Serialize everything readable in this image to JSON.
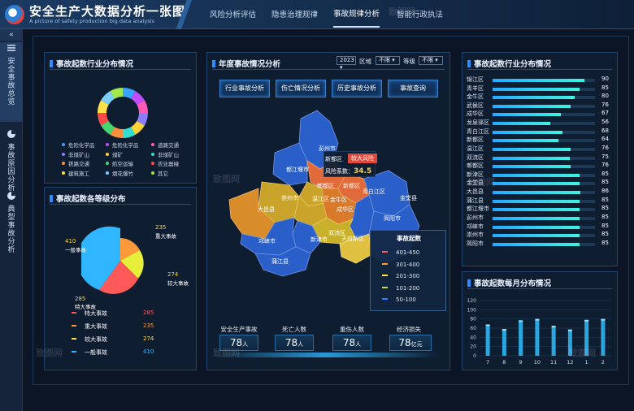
{
  "header": {
    "title": "安全生产大数据分析一张图",
    "subtitle": "A picture of safety production big data analysis",
    "nav": [
      "风险分析评估",
      "隐患治理规律",
      "事故规律分析",
      "智能行政执法"
    ],
    "active_nav": 2
  },
  "sidebar": {
    "collapse_icon": "«",
    "items": [
      {
        "label": "安全事故总览",
        "icon": "menu-icon"
      },
      {
        "label": "事故原因分析",
        "icon": "pie-icon"
      },
      {
        "label": "典型事故分析",
        "icon": "pie-icon"
      }
    ]
  },
  "industry_panel": {
    "title": "事故起数行业分布情况",
    "legend": [
      {
        "label": "危险化学品",
        "color": "#3aa3ff"
      },
      {
        "label": "危险化学品",
        "color": "#c04bff"
      },
      {
        "label": "道路交通",
        "color": "#ff5bb6"
      },
      {
        "label": "非煤矿山",
        "color": "#8a7dff"
      },
      {
        "label": "煤矿",
        "color": "#ffd23a"
      },
      {
        "label": "非煤矿山",
        "color": "#31e0d0"
      },
      {
        "label": "铁路交通",
        "color": "#ff8e3a"
      },
      {
        "label": "航空运输",
        "color": "#45d66f"
      },
      {
        "label": "农业器械",
        "color": "#ff4a4a"
      },
      {
        "label": "建筑施工",
        "color": "#ffe14a"
      },
      {
        "label": "烟花爆竹",
        "color": "#7cd0ff"
      },
      {
        "label": "其它",
        "color": "#a3e84a"
      }
    ]
  },
  "grade_panel": {
    "title": "事故起数各等级分布",
    "labels": [
      {
        "value": "235",
        "name": "重大事故"
      },
      {
        "value": "410",
        "name": "一般事故"
      },
      {
        "value": "274",
        "name": "较大事故"
      },
      {
        "value": "285",
        "name": "特大事故"
      }
    ],
    "rows": [
      {
        "name": "特大事故",
        "value": "285",
        "color": "#ff5a5a"
      },
      {
        "name": "重大事故",
        "value": "235",
        "color": "#ff9a3a"
      },
      {
        "name": "较大事故",
        "value": "274",
        "color": "#ffe14a"
      },
      {
        "name": "一般事故",
        "value": "410",
        "color": "#2fb6ff"
      }
    ]
  },
  "center": {
    "title": "年度事故情况分析",
    "year": "2023",
    "district_label": "区域",
    "district_value": "不限",
    "level_label": "等级",
    "level_value": "不限",
    "tabs": [
      "行业事故分析",
      "伤亡情况分析",
      "历史事故分析",
      "事故查询"
    ],
    "tooltip": {
      "city": "新都区",
      "risk": "较大风险",
      "coef_label": "风险系数：",
      "coef": "34.5"
    },
    "map_labels": [
      "彭州市",
      "都江堰市",
      "新都区",
      "郫都区",
      "崇州市",
      "温江区",
      "青白江区",
      "金堂县",
      "大邑县",
      "金牛区",
      "成华区",
      "双流区",
      "邛崃市",
      "新津市",
      "蒲江县",
      "天府新区",
      "简阳市"
    ],
    "legend": {
      "title": "事故起数",
      "items": [
        {
          "label": "401-450",
          "color": "#ff5a5a"
        },
        {
          "label": "301-400",
          "color": "#ff9a3a"
        },
        {
          "label": "201-300",
          "color": "#ffe14a"
        },
        {
          "label": "101-200",
          "color": "#d6d64a"
        },
        {
          "label": "50-100",
          "color": "#2f7fff"
        }
      ]
    },
    "stats": [
      {
        "label": "安全生产事故",
        "value": "78",
        "unit": "人"
      },
      {
        "label": "死亡人数",
        "value": "78",
        "unit": "人"
      },
      {
        "label": "重伤人数",
        "value": "78",
        "unit": "人"
      },
      {
        "label": "经济损失",
        "value": "78",
        "unit": "亿元"
      }
    ]
  },
  "district_panel": {
    "title": "事故起数行业分布情况",
    "rows": [
      {
        "name": "锦江区",
        "value": 90
      },
      {
        "name": "青羊区",
        "value": 85
      },
      {
        "name": "金牛区",
        "value": 80
      },
      {
        "name": "武侯区",
        "value": 76
      },
      {
        "name": "成华区",
        "value": 67
      },
      {
        "name": "龙泉驿区",
        "value": 56
      },
      {
        "name": "青白江区",
        "value": 68
      },
      {
        "name": "新都区",
        "value": 64
      },
      {
        "name": "温江区",
        "value": 76
      },
      {
        "name": "双流区",
        "value": 75
      },
      {
        "name": "郫都区",
        "value": 76
      },
      {
        "name": "新津区",
        "value": 85
      },
      {
        "name": "金堂县",
        "value": 85
      },
      {
        "name": "大邑县",
        "value": 86
      },
      {
        "name": "蒲江县",
        "value": 85
      },
      {
        "name": "都江堰市",
        "value": 85
      },
      {
        "name": "彭州市",
        "value": 85
      },
      {
        "name": "邛崃市",
        "value": 85
      },
      {
        "name": "崇州市",
        "value": 85
      },
      {
        "name": "简阳市",
        "value": 85
      }
    ]
  },
  "chart_data": {
    "type": "bar",
    "title": "事故起数每月分布情况",
    "categories": [
      "7",
      "8",
      "9",
      "10",
      "11",
      "12",
      "1",
      "2"
    ],
    "values": [
      68,
      58,
      77,
      80,
      65,
      57,
      78,
      80
    ],
    "ylim": [
      0,
      120
    ],
    "yticks": [
      0,
      20,
      40,
      60,
      80,
      100,
      120
    ]
  },
  "watermark": "致图网"
}
